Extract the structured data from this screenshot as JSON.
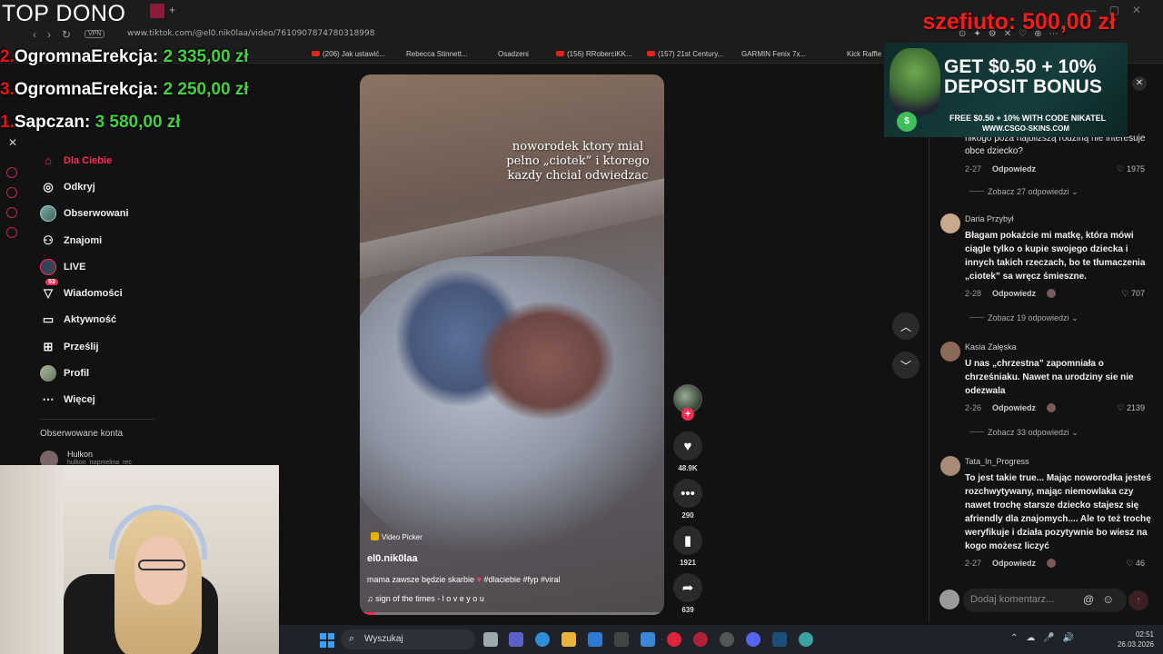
{
  "overlay": {
    "top_dono_title": "TOP DONO",
    "donations": [
      {
        "rank": "2.",
        "name": "OgromnaErekcja:",
        "amount": "2 335,00 zł"
      },
      {
        "rank": "3.",
        "name": "OgromnaErekcja:",
        "amount": "2 250,00 zł"
      },
      {
        "rank": "1.",
        "name": "Sapczan:",
        "amount": "3 580,00 zł"
      }
    ],
    "top_right_donor": "szefiuto: 500,00 zł"
  },
  "browser": {
    "vpn_label": "VPN",
    "url": "www.tiktok.com/@el0.nik0laa/video/7610907874780318998",
    "bookmarks": [
      "(206) Jak ustawić...",
      "Rebecca Stinnett...",
      "Osadzeni",
      "(156) RRoberciKK...",
      "(157) 21st Century...",
      "GARMIN Fenix 7x...",
      "Kick Raffle"
    ]
  },
  "sidebar": {
    "items": [
      {
        "label": "Dla Ciebie",
        "icon": "home-icon"
      },
      {
        "label": "Odkryj",
        "icon": "compass-icon"
      },
      {
        "label": "Obserwowani",
        "icon": "avatar-icon"
      },
      {
        "label": "Znajomi",
        "icon": "friends-icon"
      },
      {
        "label": "LIVE",
        "icon": "live-icon"
      },
      {
        "label": "Wiadomości",
        "icon": "messages-icon",
        "badge": "53"
      },
      {
        "label": "Aktywność",
        "icon": "activity-icon"
      },
      {
        "label": "Prześlij",
        "icon": "upload-icon"
      },
      {
        "label": "Profil",
        "icon": "profile-icon"
      },
      {
        "label": "Więcej",
        "icon": "more-icon"
      }
    ],
    "followed_title": "Obserwowane konta",
    "followed_accounts": [
      {
        "name": "Hulkon",
        "handle": "hulkon_trapmelina_rec"
      }
    ]
  },
  "video": {
    "caption_overlay": "noworodek ktory mial pelno „ciotek” i ktorego kazdy chcial odwiedzac",
    "tag": "Video Picker",
    "username": "el0.nik0laa",
    "description": "mama zawsze będzie skarbie",
    "hashtags": "#dlaciebie #fyp #viral",
    "music": "sign of the times - l o v e y o u",
    "progress": 0.05
  },
  "actions": {
    "likes": "48.9K",
    "comments": "290",
    "saves": "1921",
    "shares": "639"
  },
  "comments": {
    "top_partial_text": "nikogo poza najbliższą rodziną nie interesuje obce dziecko?",
    "top_partial_date": "2-27",
    "top_partial_likes": "1975",
    "reply_label": "Odpowiedz",
    "items": [
      {
        "more_replies": "Zobacz 27 odpowiedzi",
        "user": "Daria Przybył",
        "text": "Błagam pokażcie mi matkę, która mówi ciągle tylko o kupie swojego dziecka i innych takich rzeczach, bo te tłumaczenia „ciotek” sa wręcz śmieszne.",
        "date": "2-28",
        "likes": "707"
      },
      {
        "more_replies": "Zobacz 19 odpowiedzi",
        "user": "Kasia Załęska",
        "text": "U nas „chrzestna” zapomniała o chrześniaku. Nawet na urodziny sie nie odezwala",
        "date": "2-26",
        "likes": "2139"
      },
      {
        "more_replies": "Zobacz 33 odpowiedzi",
        "user": "Tata_In_Progress",
        "text": "To jest takie true... Mając noworodka jesteś rozchwytywany, mając niemowlaka czy nawet trochę starsze dziecko stajesz się afriendly dla znajomych.... Ale to też trochę weryfikuje i działa pozytywnie bo wiesz na kogo możesz liczyć",
        "date": "2-27",
        "likes": "46"
      }
    ],
    "input_placeholder": "Dodaj komentarz...",
    "at_symbol": "@"
  },
  "ad": {
    "headline": "GET $0.50 + 10% DEPOSIT BONUS",
    "line1": "FREE $0.50 + 10% WITH CODE NIKATEL",
    "line2": "WWW.CSGO-SKINS.COM"
  },
  "taskbar": {
    "search_label": "Wyszukaj",
    "time": "02:51",
    "date": "26.03.2026"
  },
  "colors": {
    "accent": "#fe2c55",
    "donation_amount": "#43d141",
    "donation_rank": "#e11111",
    "top_donor": "#ff1a1a"
  }
}
